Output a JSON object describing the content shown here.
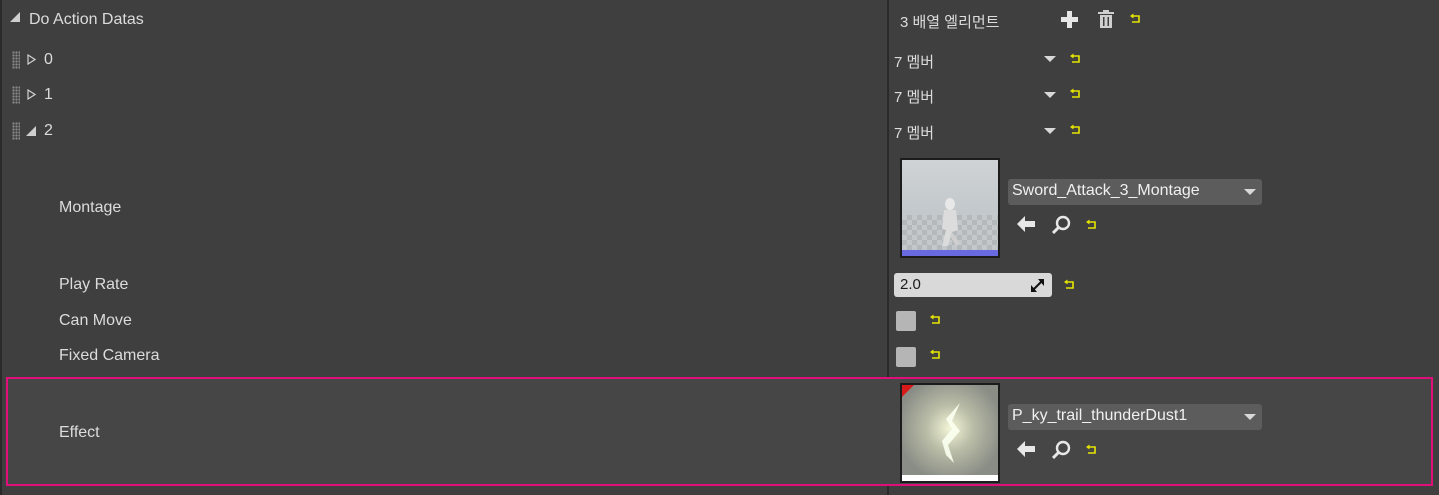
{
  "header": {
    "title": "Do Action Datas",
    "element_count": "3 배열 엘리먼트"
  },
  "array_items": [
    {
      "index": "0",
      "value": "7 멤버",
      "expanded": false
    },
    {
      "index": "1",
      "value": "7 멤버",
      "expanded": false
    },
    {
      "index": "2",
      "value": "7 멤버",
      "expanded": true
    }
  ],
  "properties": {
    "montage": {
      "label": "Montage",
      "asset": "Sword_Attack_3_Montage"
    },
    "play_rate": {
      "label": "Play Rate",
      "value": "2.0"
    },
    "can_move": {
      "label": "Can Move",
      "checked": false
    },
    "fixed_camera": {
      "label": "Fixed Camera",
      "checked": false
    },
    "effect": {
      "label": "Effect",
      "asset": "P_ky_trail_thunderDust1"
    }
  },
  "colors": {
    "background": "#3f3f3f",
    "highlight_border": "#e0107a",
    "reset_arrow": "#e6e600",
    "montage_bar": "#6a6ae0"
  },
  "icons": [
    "plus-icon",
    "trash-icon",
    "reset-to-default-icon",
    "dropdown-arrow-icon",
    "browse-back-arrow-icon",
    "search-icon",
    "drag-grip-icon",
    "expand-triangle-icon",
    "scale-icon"
  ]
}
